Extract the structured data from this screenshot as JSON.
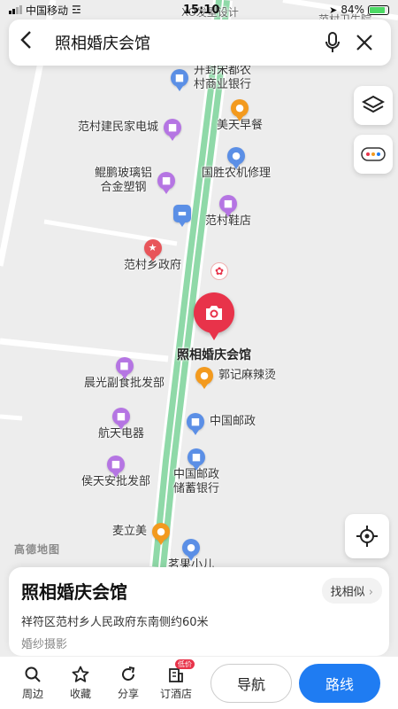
{
  "status_bar": {
    "carrier": "中国移动",
    "time": "15:10",
    "battery": "84%"
  },
  "search": {
    "query": "照相婚庆会馆"
  },
  "map": {
    "top_cut_label": "XO发型设计",
    "top_right_cut_label": "范村卫生院",
    "bottom_cut_label": "茗果小儿",
    "logo": "高德地图",
    "pois": [
      {
        "label": "开封宋都农\n村商业银行",
        "color": "blue",
        "icon": "bank-icon"
      },
      {
        "label": "美天早餐",
        "color": "orange",
        "icon": "food-icon"
      },
      {
        "label": "范村建民家电城",
        "color": "purple",
        "icon": "shop-icon"
      },
      {
        "label": "国胜农机修理",
        "color": "blue",
        "icon": "location-icon"
      },
      {
        "label": "鲲鹏玻璃铝\n合金塑钢",
        "color": "purple",
        "icon": "shop-icon"
      },
      {
        "label": "范村鞋店",
        "color": "purple",
        "icon": "shop-icon"
      },
      {
        "label": "范村乡政府",
        "color": "red",
        "icon": "government-icon"
      },
      {
        "label": "郭记麻辣烫",
        "color": "orange",
        "icon": "food-icon"
      },
      {
        "label": "晨光副食批发部",
        "color": "purple",
        "icon": "shop-icon"
      },
      {
        "label": "中国邮政",
        "color": "blue",
        "icon": "post-icon"
      },
      {
        "label": "航天电器",
        "color": "purple",
        "icon": "shop-icon"
      },
      {
        "label": "中国邮政\n储蓄银行",
        "color": "blue",
        "icon": "bank-icon"
      },
      {
        "label": "侯天安批发部",
        "color": "purple",
        "icon": "shop-icon"
      },
      {
        "label": "麦立美",
        "color": "orange",
        "icon": "food-icon"
      }
    ],
    "selected_label": "照相婚庆会馆"
  },
  "card": {
    "name": "照相婚庆会馆",
    "address": "祥符区范村乡人民政府东南侧约60米",
    "category": "婚纱摄影",
    "find_similar": "找相似"
  },
  "toolbar": {
    "items": [
      {
        "label": "周边",
        "icon": "search-icon"
      },
      {
        "label": "收藏",
        "icon": "star-icon"
      },
      {
        "label": "分享",
        "icon": "share-icon"
      },
      {
        "label": "订酒店",
        "icon": "hotel-icon",
        "badge": "低价"
      }
    ],
    "navigate": "导航",
    "route": "路线"
  },
  "colors": {
    "accent_blue": "#1f7cf2",
    "marker_red": "#e8334a",
    "road_green": "#8fd9a8"
  }
}
